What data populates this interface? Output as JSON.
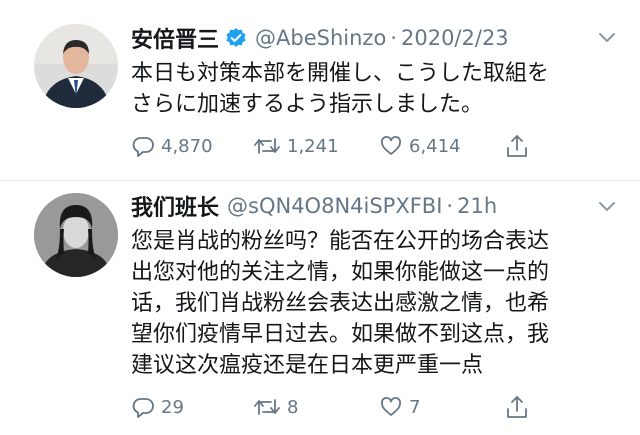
{
  "tweets": [
    {
      "name": "安倍晋三",
      "verified": true,
      "handle": "@AbeShinzo",
      "separator": "·",
      "time": "2020/2/23",
      "text": "本日も対策本部を開催し、こうした取組を\nさらに加速するよう指示しました。",
      "replies": "4,870",
      "retweets": "1,241",
      "likes": "6,414"
    },
    {
      "name": "我们班长",
      "verified": false,
      "handle": "@sQN4O8N4iSPXFBI",
      "separator": "·",
      "time": "21h",
      "text": "您是肖战的粉丝吗？能否在公开的场合表达\n出您对他的关注之情，如果你能做这一点的\n话，我们肖战粉丝会表达出感激之情，也希\n望你们疫情早日过去。如果做不到这点，我\n建议这次瘟疫还是在日本更严重一点",
      "replies": "29",
      "retweets": "8",
      "likes": "7"
    }
  ],
  "colors": {
    "text": "#14171a",
    "secondary": "#657786",
    "verified": "#1da1f2",
    "divider": "#e6ecf0"
  },
  "icons": [
    "verified-badge-icon",
    "chevron-down-icon",
    "reply-icon",
    "retweet-icon",
    "like-icon",
    "share-icon"
  ]
}
